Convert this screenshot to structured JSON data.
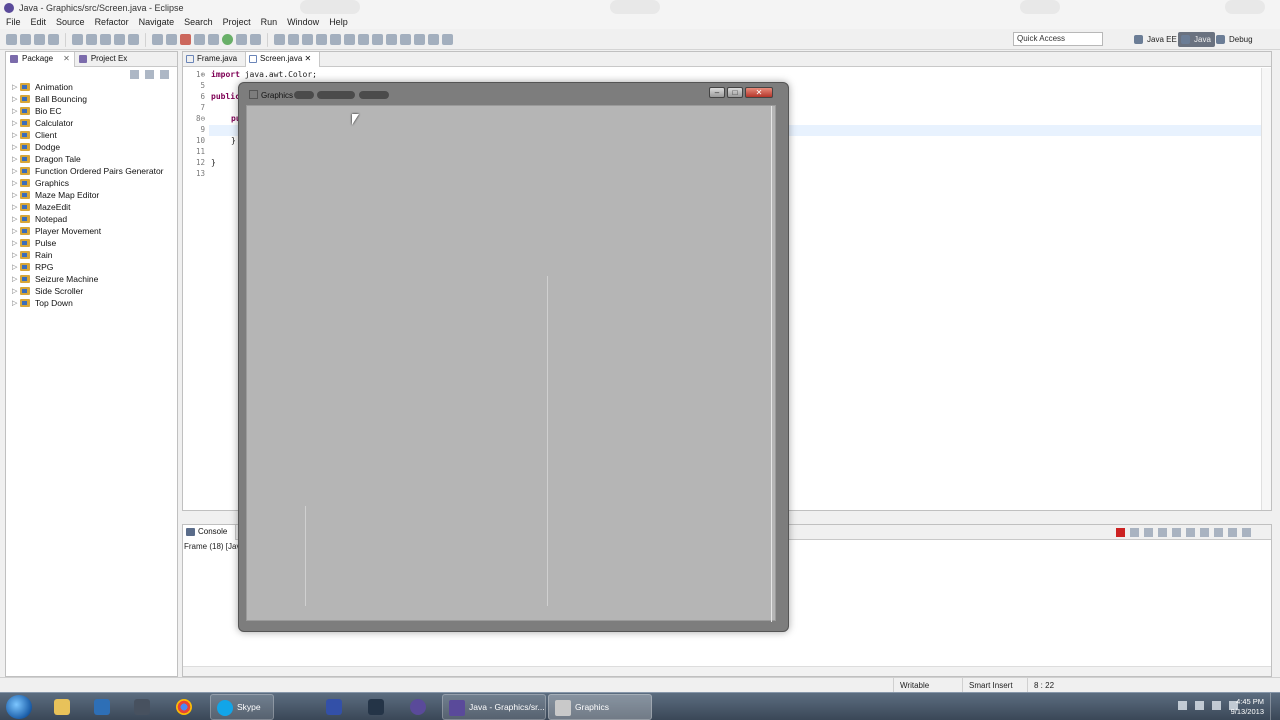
{
  "window": {
    "title": "Java - Graphics/src/Screen.java - Eclipse"
  },
  "menu": [
    "File",
    "Edit",
    "Source",
    "Refactor",
    "Navigate",
    "Search",
    "Project",
    "Run",
    "Window",
    "Help"
  ],
  "quick_access": {
    "placeholder": "Quick Access"
  },
  "perspectives": [
    "Java EE",
    "Java",
    "Debug"
  ],
  "left_panel": {
    "tabs": [
      "Package",
      "Project Ex"
    ],
    "projects": [
      "Animation",
      "Ball Bouncing",
      "Bio EC",
      "Calculator",
      "Client",
      "Dodge",
      "Dragon Tale",
      "Function Ordered Pairs Generator",
      "Graphics",
      "Maze Map Editor",
      "MazeEdit",
      "Notepad",
      "Player Movement",
      "Pulse",
      "Rain",
      "RPG",
      "Seizure Machine",
      "Side Scroller",
      "Top Down"
    ]
  },
  "editor": {
    "tabs": [
      "Frame.java",
      "Screen.java"
    ],
    "line_numbers": [
      "1⊕",
      "5",
      "6",
      "7",
      "8⊖",
      "9",
      "10",
      "11",
      "12",
      "13"
    ],
    "code": {
      "line1_kw": "import",
      "line1_rest": "java.awt.Color;",
      "line6": "public",
      "line8": "pu",
      "line10": "}",
      "line12": "}"
    }
  },
  "console": {
    "tab": "Console",
    "status": "Frame (18) [Java"
  },
  "statusbar": {
    "writable": "Writable",
    "insert_mode": "Smart Insert",
    "position": "8 : 22"
  },
  "running_frame": {
    "title": "Graphics"
  },
  "taskbar": {
    "skype_label": "Skype",
    "eclipse_label": "Java - Graphics/sr...",
    "graphics_label": "Graphics",
    "clock_time": "4:45 PM",
    "clock_date": "9/13/2013"
  }
}
